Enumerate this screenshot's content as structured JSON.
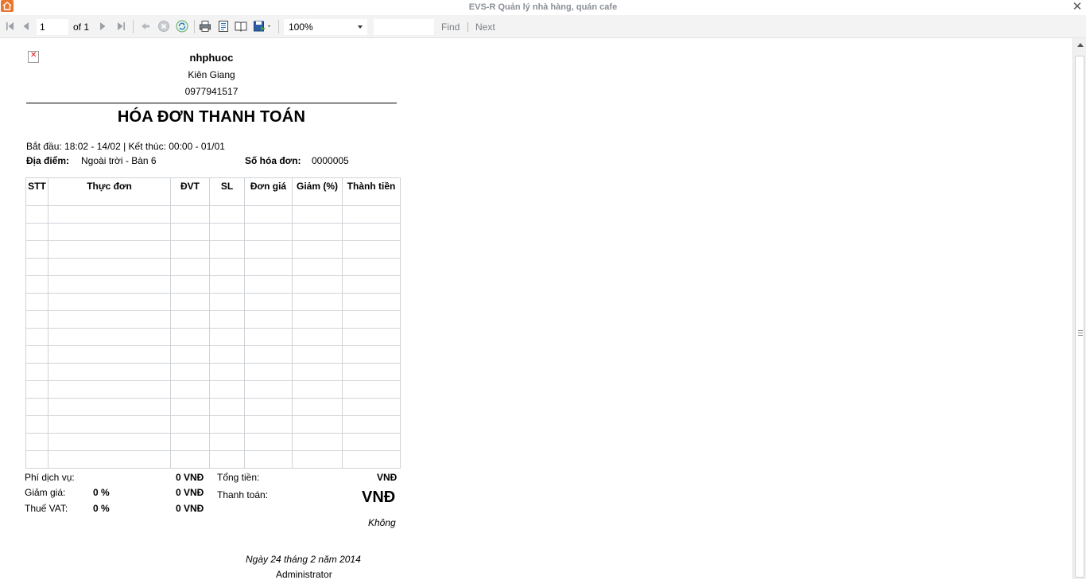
{
  "window": {
    "title": "EVS-R Quản lý nhà hàng, quán cafe"
  },
  "toolbar": {
    "page_value": "1",
    "of_label": "of 1",
    "zoom": "100%",
    "find_label": "Find",
    "next_label": "Next"
  },
  "report": {
    "shop_name": "nhphuoc",
    "shop_address": "Kiên Giang",
    "shop_phone": "0977941517",
    "title": "HÓA ĐƠN THANH TOÁN",
    "time_line": "Bắt đầu: 18:02 - 14/02 | Kết thúc: 00:00 - 01/01",
    "location_label": "Địa điểm:",
    "location_value": "Ngoài trời - Bàn 6",
    "invoice_no_label": "Số hóa đơn:",
    "invoice_no_value": "0000005",
    "columns": [
      "STT",
      "Thực đơn",
      "ĐVT",
      "SL",
      "Đơn giá",
      "Giảm (%)",
      "Thành tiền"
    ],
    "summary": {
      "service_fee_label": "Phí dịch vụ:",
      "service_fee_value": "0 VNĐ",
      "discount_label": "Giảm giá:",
      "discount_percent": "0 %",
      "discount_value": "0 VNĐ",
      "vat_label": "Thuế VAT:",
      "vat_percent": "0 %",
      "vat_value": "0 VNĐ",
      "total_label": "Tổng tiền:",
      "total_value": "VNĐ",
      "payment_label": "Thanh toán:",
      "payment_value": "VNĐ",
      "amount_in_words": "Không"
    },
    "date_line": "Ngày 24 tháng 2 năm 2014",
    "signer": "Administrator"
  }
}
